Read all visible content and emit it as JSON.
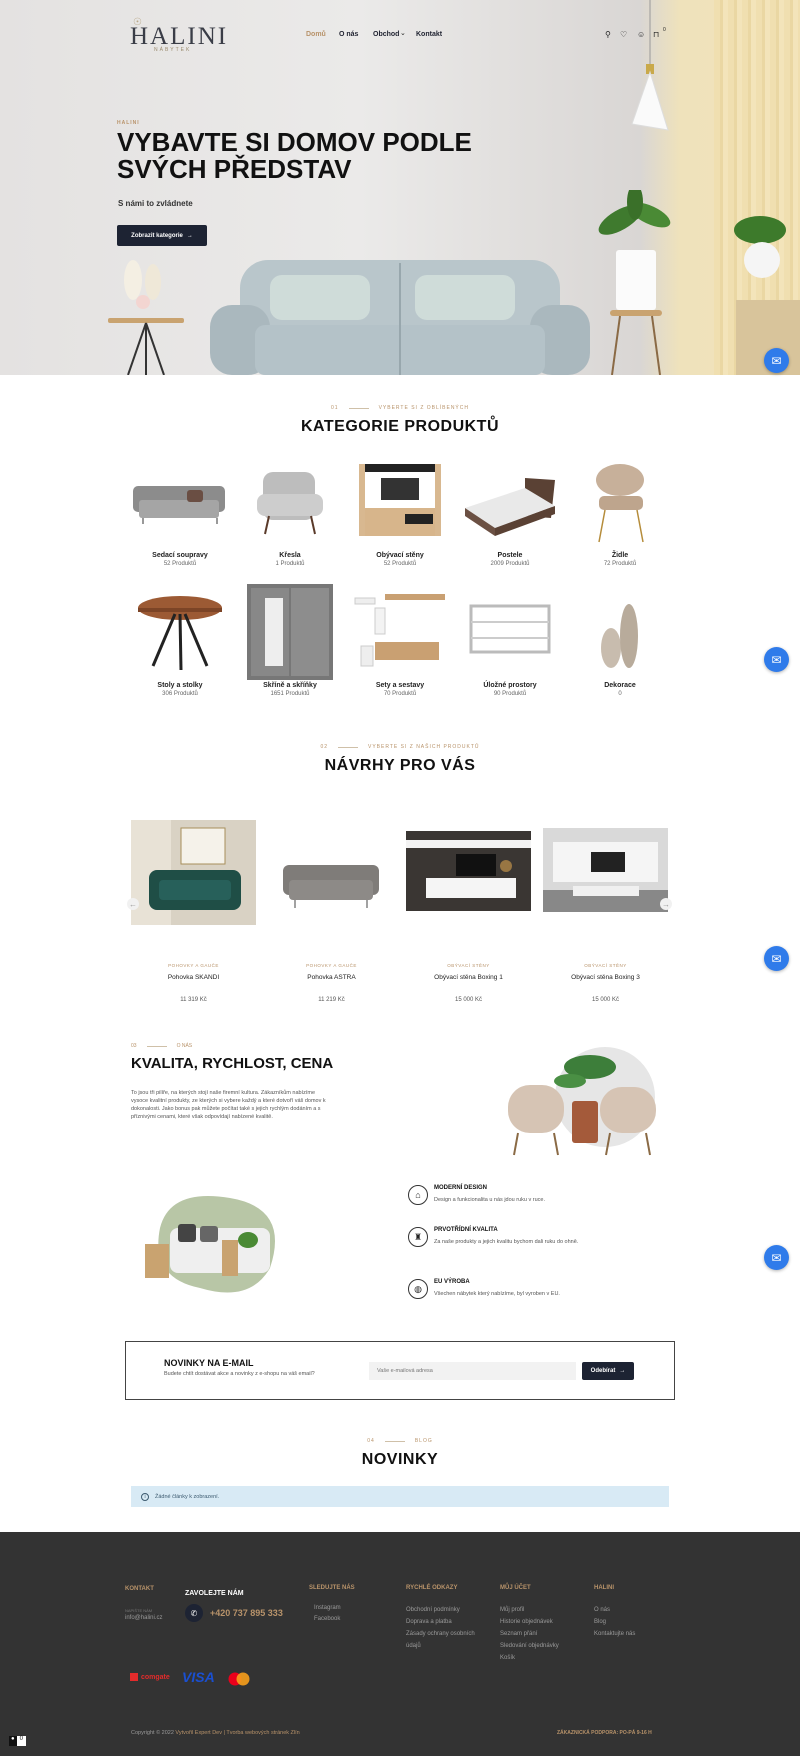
{
  "brand": {
    "logo_top": "☉",
    "name": "HALINI",
    "tagline": "NÁBYTEK"
  },
  "nav": {
    "items": [
      {
        "label": "Domů",
        "active": true
      },
      {
        "label": "O nás"
      },
      {
        "label": "Obchod"
      },
      {
        "label": "Kontakt"
      }
    ],
    "shop_caret": "⌄"
  },
  "header_icons": {
    "search": "search-icon",
    "wishlist": "heart-icon",
    "account": "user-icon",
    "cart": "cart-icon",
    "cart_count": "0"
  },
  "hero": {
    "eyebrow": "HALINI",
    "title": "VYBAVTE SI DOMOV PODLE SVÝCH PŘEDSTAV",
    "subtitle": "S námi to zvládnete",
    "button": "Zobrazit kategorie",
    "button_arrow": "→"
  },
  "categories": {
    "eyebrow_num": "01",
    "eyebrow": "VYBERTE SI Z OBLÍBENÝCH",
    "title": "KATEGORIE PRODUKTŮ",
    "items": [
      {
        "name": "Sedací soupravy",
        "count": "52 Produktů"
      },
      {
        "name": "Křesla",
        "count": "1 Produktů"
      },
      {
        "name": "Obývací stěny",
        "count": "52 Produktů"
      },
      {
        "name": "Postele",
        "count": "2009 Produktů"
      },
      {
        "name": "Židle",
        "count": "72 Produktů"
      },
      {
        "name": "Stoly a stolky",
        "count": "306 Produktů"
      },
      {
        "name": "Skříně a skříňky",
        "count": "1651 Produktů"
      },
      {
        "name": "Sety a sestavy",
        "count": "70 Produktů"
      },
      {
        "name": "Úložné prostory",
        "count": "90 Produktů"
      },
      {
        "name": "Dekorace",
        "count": "0"
      }
    ]
  },
  "products": {
    "eyebrow_num": "02",
    "eyebrow": "VYBERTE SI Z NAŠICH PRODUKTŮ",
    "title": "NÁVRHY PRO VÁS",
    "prev": "←",
    "next": "→",
    "items": [
      {
        "category": "POHOVKY A GAUČE",
        "name": "Pohovka SKANDI",
        "price": "11 319 Kč"
      },
      {
        "category": "POHOVKY A GAUČE",
        "name": "Pohovka ASTRA",
        "price": "11 219 Kč"
      },
      {
        "category": "OBÝVACÍ STĚNY",
        "name": "Obývací stěna Boxing 1",
        "price": "15 000 Kč"
      },
      {
        "category": "OBÝVACÍ STĚNY",
        "name": "Obývací stěna Boxing 3",
        "price": "15 000 Kč"
      }
    ]
  },
  "about": {
    "eyebrow_num": "03",
    "eyebrow": "O NÁS",
    "title": "KVALITA, RYCHLOST, CENA",
    "text": "To jsou tři pilíře, na kterých stojí naše firemní kultura. Zákazníkům nabízíme vysoce kvalitní produkty, ze kterých si vybere každý a které dotvoří váš domov k dokonalosti. Jako bonus pak můžete počítat také s jejich rychlým dodáním a s příznivými cenami, které však odpovídají nabízené kvalitě.",
    "features": [
      {
        "title": "MODERNÍ DESIGN",
        "text": "Design a funkcionalita u nás jdou ruku v ruce.",
        "icon": "chair-icon"
      },
      {
        "title": "PRVOTŘÍDNÍ KVALITA",
        "text": "Za naše produkty a jejich kvalitu bychom dali ruku do ohně.",
        "icon": "armchair-icon"
      },
      {
        "title": "EU VÝROBA",
        "text": "Všechen nábytek který nabízíme, byl vyroben v EU.",
        "icon": "globe-icon"
      }
    ]
  },
  "newsletter": {
    "title": "NOVINKY NA E-MAIL",
    "text": "Budete chtít dostávat akce a novinky z e-shopu na váš email?",
    "placeholder": "Vaše e-mailová adresa",
    "button": "Odebírat",
    "arrow": "→"
  },
  "blog": {
    "eyebrow_num": "04",
    "eyebrow": "BLOG",
    "title": "NOVINKY",
    "notice": "Žádné články k zobrazení.",
    "info_icon": "i"
  },
  "footer": {
    "contact": {
      "heading": "KONTAKT",
      "label": "NAPIŠTE NÁM",
      "email": "info@halini.cz"
    },
    "call": {
      "heading": "ZAVOLEJTE NÁM",
      "phone": "+420 737 895 333"
    },
    "follow": {
      "heading": "SLEDUJTE NÁS",
      "links": [
        "Instagram",
        "Facebook"
      ]
    },
    "quick": {
      "heading": "RYCHLÉ ODKAZY",
      "links": [
        "Obchodní podmínky",
        "Doprava a platba",
        "Zásady ochrany osobních",
        "údajů"
      ]
    },
    "account": {
      "heading": "MŮJ ÚČET",
      "links": [
        "Můj profil",
        "Historie objednávek",
        "Seznam přání",
        "Sledování objednávky",
        "Košík"
      ]
    },
    "halini": {
      "heading": "HALINI",
      "links": [
        "O nás",
        "Blog",
        "Kontaktujte nás"
      ]
    },
    "payments": {
      "homecredit": "comgate",
      "visa": "VISA"
    },
    "copyright_pre": "Copyright © 2022",
    "copyright_link": "Vytvořil Expert Dev | Tvorba webových stránek Zlín",
    "support": "ZÁKAZNICKÁ PODPORA: PO-PÁ 9-16 H",
    "cookie_count": "0"
  },
  "colors": {
    "accent": "#b8936a",
    "dark": "#1d2333",
    "footer": "#333333",
    "messenger": "#2f7bea"
  }
}
